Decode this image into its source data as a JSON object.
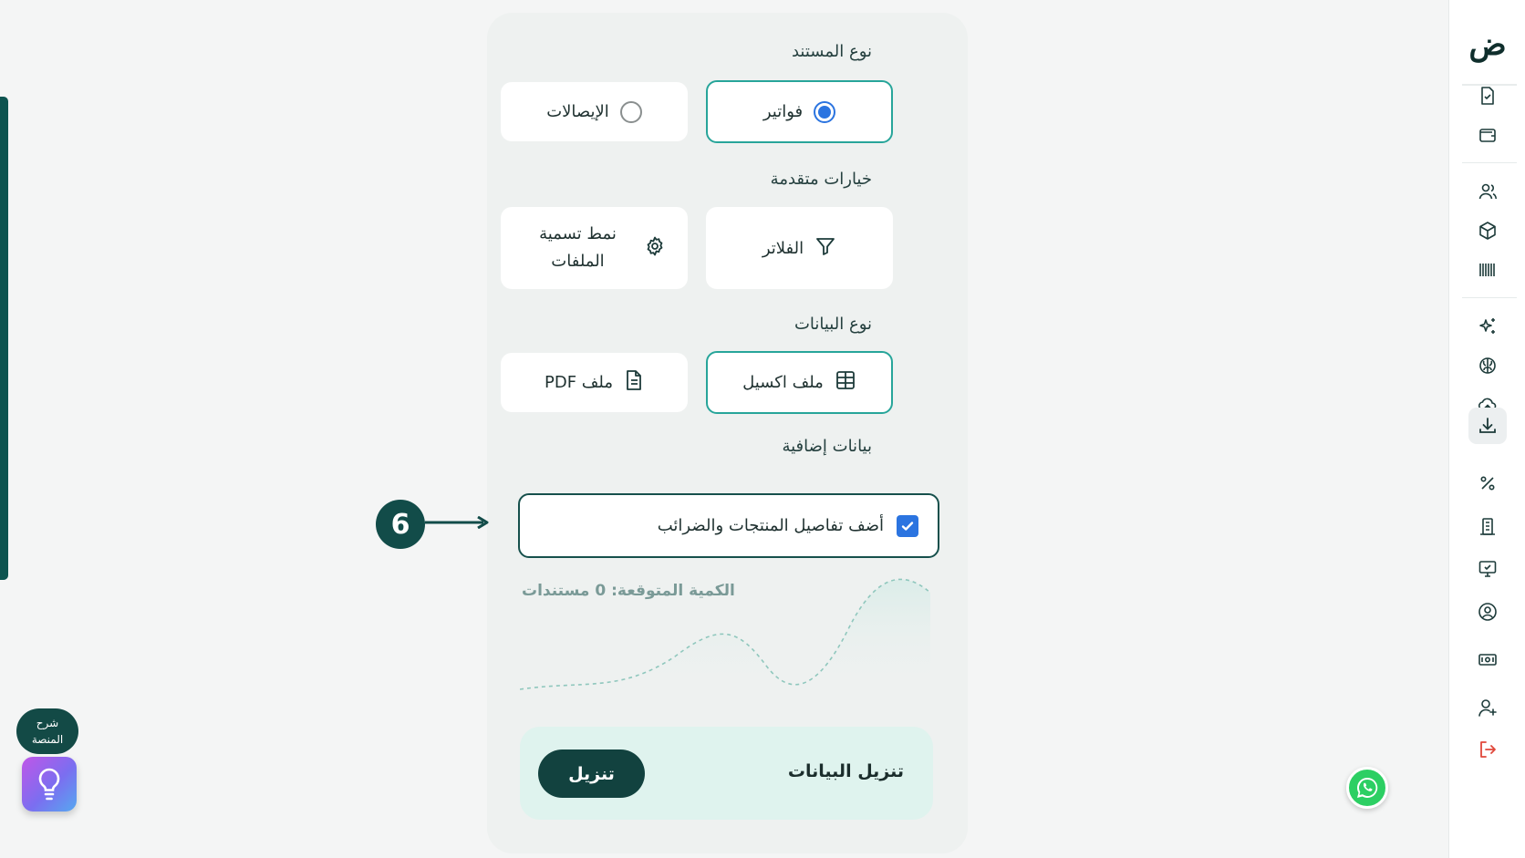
{
  "sidebar": {
    "logo_text": "ض",
    "icons": [
      {
        "name": "file-check-icon",
        "active": false
      },
      {
        "name": "wallet-icon",
        "active": false
      },
      {
        "name": "users-icon",
        "active": false
      },
      {
        "name": "box-icon",
        "active": false
      },
      {
        "name": "barcode-icon",
        "active": false
      },
      {
        "name": "sparkles-icon",
        "active": false
      },
      {
        "name": "brain-icon",
        "active": false
      },
      {
        "name": "cloud-upload-icon",
        "active": false
      },
      {
        "name": "download-icon",
        "active": true
      },
      {
        "name": "percent-icon",
        "active": false
      },
      {
        "name": "building-icon",
        "active": false
      },
      {
        "name": "monitor-check-icon",
        "active": false
      },
      {
        "name": "user-circle-icon",
        "active": false
      },
      {
        "name": "banknote-icon",
        "active": false
      },
      {
        "name": "user-plus-icon",
        "active": false
      },
      {
        "name": "logout-icon",
        "active": false
      }
    ]
  },
  "document_type": {
    "title": "نوع المستند",
    "options": [
      {
        "label": "فواتير",
        "selected": true
      },
      {
        "label": "الإيصالات",
        "selected": false
      }
    ]
  },
  "advanced": {
    "title": "خيارات متقدمة",
    "filters_label": "الفلاتر",
    "naming_label": "نمط تسمية الملفات"
  },
  "data_type": {
    "title": "نوع البيانات",
    "excel_label": "ملف اكسيل",
    "pdf_label": "ملف PDF",
    "selected": "excel"
  },
  "extra": {
    "title": "بيانات إضافية",
    "checkbox_label": "أضف تفاصيل المنتجات والضرائب",
    "checked": true
  },
  "step_number": "6",
  "expected_text": "الكمية المتوقعة: 0 مستندات",
  "download": {
    "title": "تنزيل البيانات",
    "button_label": "تنزيل"
  },
  "help": {
    "line1": "شرح",
    "line2": "المنصة"
  },
  "colors": {
    "primary": "#12423f",
    "accent": "#27a59a",
    "radio": "#2b74e0",
    "danger": "#e0473a"
  }
}
